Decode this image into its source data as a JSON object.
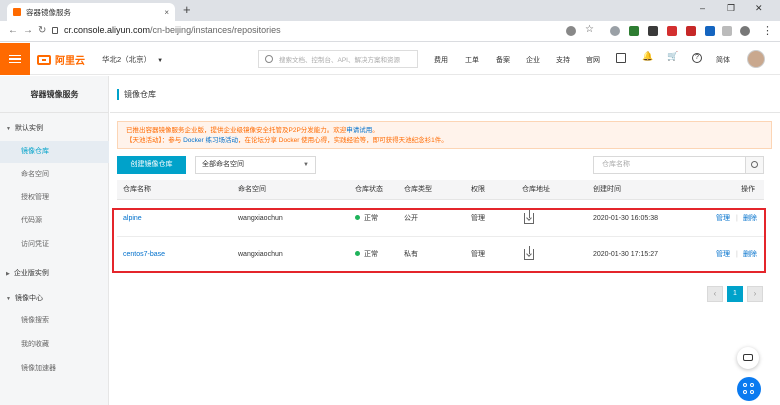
{
  "browser": {
    "tab_title": "容器镜像服务",
    "tab_close": "×",
    "new_tab": "+",
    "url_host": "cr.console.aliyun.com",
    "url_path": "/cn-beijing/instances/repositories",
    "win_min": "–",
    "win_max": "❐",
    "win_close": "✕",
    "back": "←",
    "forward": "→",
    "reload": "↻",
    "menu": "⋮"
  },
  "header": {
    "logo_text": "阿里云",
    "region": "华北2（北京）",
    "search_placeholder": "搜索文档、控制台、API、解决方案和资源",
    "nav": [
      "费用",
      "工单",
      "备案",
      "企业",
      "支持",
      "官网"
    ],
    "lang": "简体",
    "brand_color": "#ff6a00"
  },
  "sidebar": {
    "title": "容器镜像服务",
    "groups": {
      "default_instance": "默认实例",
      "enterprise_instance": "企业版实例",
      "image_center": "镜像中心"
    },
    "items": {
      "repositories": "镜像仓库",
      "namespaces": "命名空间",
      "authorization": "授权管理",
      "code_source": "代码源",
      "access_credential": "访问凭证",
      "image_search": "镜像搜索",
      "favorites": "我的收藏",
      "accelerator": "镜像加速器"
    }
  },
  "main": {
    "page_title": "镜像仓库",
    "notice_line1_a": "已推出容器镜像服务企业版，提供企业级镜像安全托管及P2P分发能力。欢迎",
    "notice_line1_link": "申请试用",
    "notice_line1_b": "。",
    "notice_line2_a": "【天池活动】：参与 ",
    "notice_line2_link": "Docker 练习场活动",
    "notice_line2_b": "，在论坛分享 Docker 使用心得，实践经验等，即可获得天池纪念衫1件。",
    "create_button": "创建镜像仓库",
    "namespace_select": "全部命名空间",
    "repo_search_placeholder": "仓库名称",
    "columns": [
      "仓库名称",
      "命名空间",
      "仓库状态",
      "仓库类型",
      "权限",
      "仓库地址",
      "创建时间",
      "操作"
    ],
    "rows": [
      {
        "name": "alpine",
        "namespace": "wangxiaochun",
        "status": "正常",
        "type": "公开",
        "permission": "管理",
        "created": "2020-01-30 16:05:38",
        "op_manage": "管理",
        "op_delete": "删除"
      },
      {
        "name": "centos7-base",
        "namespace": "wangxiaochun",
        "status": "正常",
        "type": "私有",
        "permission": "管理",
        "created": "2020-01-30 17:15:27",
        "op_manage": "管理",
        "op_delete": "删除"
      }
    ],
    "pager": {
      "prev": "‹",
      "current": "1",
      "next": "›"
    },
    "accent_color": "#00a2ca",
    "highlight_color": "#e4252b"
  }
}
